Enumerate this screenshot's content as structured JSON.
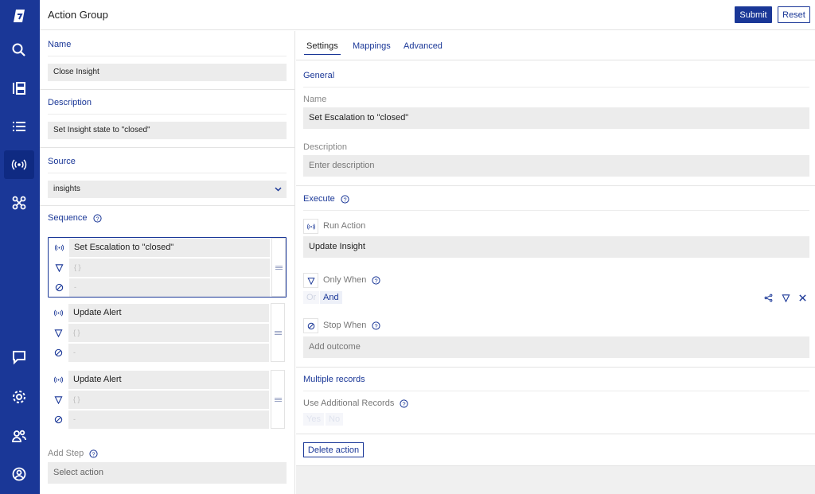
{
  "header": {
    "title": "Action Group",
    "submit_label": "Submit",
    "reset_label": "Reset"
  },
  "rail": {
    "icons": [
      "brand-logo-icon",
      "search-icon",
      "dashboard-icon",
      "list-icon",
      "broadcast-icon",
      "integrations-icon",
      "chat-icon",
      "settings-gear-icon",
      "users-icon",
      "account-icon"
    ],
    "active": "broadcast-icon"
  },
  "left": {
    "name_label": "Name",
    "name_value": "Close Insight",
    "description_label": "Description",
    "description_value": "Set Insight state to \"closed\"",
    "source_label": "Source",
    "source_value": "insights",
    "sequence_label": "Sequence",
    "steps": [
      {
        "action": "Set Escalation to \"closed\"",
        "condition": "{ }",
        "stop": "-"
      },
      {
        "action": "Update Alert",
        "condition": "{ }",
        "stop": "-"
      },
      {
        "action": "Update Alert",
        "condition": "{ }",
        "stop": "-"
      }
    ],
    "add_step_label": "Add Step",
    "add_step_placeholder": "Select action"
  },
  "right": {
    "tabs": [
      "Settings",
      "Mappings",
      "Advanced"
    ],
    "active_tab": "Settings",
    "general_label": "General",
    "name_label": "Name",
    "name_value": "Set Escalation to \"closed\"",
    "description_label": "Description",
    "description_placeholder": "Enter description",
    "execute_label": "Execute",
    "run_action_label": "Run Action",
    "run_action_value": "Update Insight",
    "only_when_label": "Only When",
    "or_label": "Or",
    "and_label": "And",
    "stop_when_label": "Stop When",
    "stop_when_placeholder": "Add outcome",
    "multiple_records_label": "Multiple records",
    "use_additional_label": "Use Additional Records",
    "yes_label": "Yes",
    "no_label": "No",
    "delete_label": "Delete action"
  },
  "colors": {
    "brand": "#1a3797",
    "field_bg": "#ececec",
    "label_grey": "#888888"
  }
}
